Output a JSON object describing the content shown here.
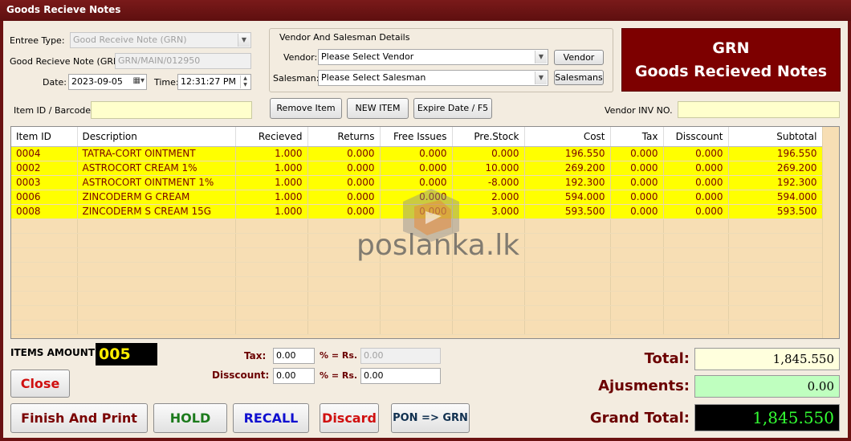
{
  "window": {
    "title": "Goods Recieve Notes"
  },
  "form": {
    "entree_type_label": "Entree Type:",
    "entree_type_value": "Good Receive Note (GRN)",
    "grn_label": "Good Recieve Note (GRN)",
    "grn_value": "GRN/MAIN/012950",
    "date_label": "Date:",
    "date_value": "2023-09-05",
    "time_label": "Time:",
    "time_value": "12:31:27 PM",
    "item_label": "Item ID / Barcode:",
    "item_value": ""
  },
  "vendor_group": {
    "title": "Vendor And Salesman Details",
    "vendor_label": "Vendor:",
    "vendor_value": "Please Select Vendor",
    "vendor_button": "Vendor",
    "salesman_label": "Salesman:",
    "salesman_value": "Please Select Salesman",
    "salesman_button": "Salesmans"
  },
  "banner": {
    "line1": "GRN",
    "line2": "Goods Recieved Notes"
  },
  "actions": {
    "remove_item": "Remove Item",
    "new_item": "NEW ITEM",
    "expire_date": "Expire Date / F5"
  },
  "vendor_inv": {
    "label": "Vendor INV NO.",
    "value": ""
  },
  "grid": {
    "columns": [
      "Item ID",
      "Description",
      "Recieved",
      "Returns",
      "Free Issues",
      "Pre.Stock",
      "Cost",
      "Tax",
      "Disscount",
      "Subtotal"
    ],
    "rows": [
      [
        "0004",
        "TATRA-CORT OINTMENT",
        "1.000",
        "0.000",
        "0.000",
        "0.000",
        "196.550",
        "0.000",
        "0.000",
        "196.550"
      ],
      [
        "0002",
        "ASTROCORT CREAM 1%",
        "1.000",
        "0.000",
        "0.000",
        "10.000",
        "269.200",
        "0.000",
        "0.000",
        "269.200"
      ],
      [
        "0003",
        "ASTROCORT OINTMENT 1%",
        "1.000",
        "0.000",
        "0.000",
        "-8.000",
        "192.300",
        "0.000",
        "0.000",
        "192.300"
      ],
      [
        "0006",
        "ZINCODERM G CREAM",
        "1.000",
        "0.000",
        "0.000",
        "2.000",
        "594.000",
        "0.000",
        "0.000",
        "594.000"
      ],
      [
        "0008",
        "ZINCODERM S CREAM 15G",
        "1.000",
        "0.000",
        "0.000",
        "3.000",
        "593.500",
        "0.000",
        "0.000",
        "593.500"
      ]
    ]
  },
  "watermark": {
    "text": "poslanka.lk"
  },
  "items_amount": {
    "label": "ITEMS AMOUNT",
    "value": "005"
  },
  "tax": {
    "label": "Tax:",
    "value": "0.00",
    "pct_label": "% = Rs.",
    "rs_value": "0.00"
  },
  "discount": {
    "label": "Disscount:",
    "value": "0.00",
    "pct_label": "% = Rs.",
    "rs_value": "0.00"
  },
  "buttons": {
    "close": "Close",
    "finish_print": "Finish And Print",
    "hold": "HOLD",
    "recall": "RECALL",
    "discard": "Discard",
    "pon_grn": "PON => GRN"
  },
  "totals": {
    "total_label": "Total:",
    "total_value": "1,845.550",
    "adjust_label": "Ajusments:",
    "adjust_value": "0.00",
    "grand_label": "Grand Total:",
    "grand_value": "1,845.550"
  },
  "colors": {
    "titlebar": "#6b1212",
    "banner": "#7d0000",
    "row_highlight": "#ffff00",
    "grid_bg": "#f7deb4",
    "grand_total_text": "#33ff33"
  }
}
